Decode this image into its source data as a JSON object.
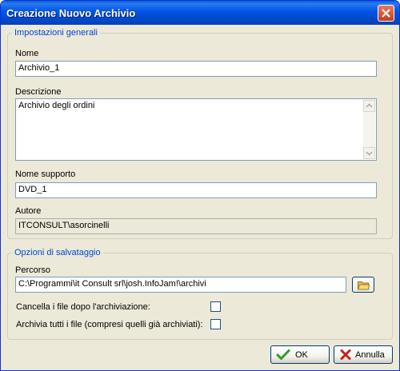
{
  "window": {
    "title": "Creazione Nuovo Archivio"
  },
  "general": {
    "legend": "Impostazioni generali",
    "name_label": "Nome",
    "name_value": "Archivio_1",
    "description_label": "Descrizione",
    "description_value": "Archivio degli ordini",
    "support_label": "Nome supporto",
    "support_value": "DVD_1",
    "author_label": "Autore",
    "author_value": "ITCONSULT\\asorcinelli"
  },
  "save": {
    "legend": "Opzioni di salvataggio",
    "path_label": "Percorso",
    "path_value": "C:\\Programmi\\it Consult srl\\josh.InfoJam!\\archivi",
    "delete_files_label": "Cancella i file dopo l'archiviazione:",
    "delete_files_checked": false,
    "archive_all_label": "Archivia tutti i file (compresi quelli già archiviati):",
    "archive_all_checked": false
  },
  "buttons": {
    "ok": "OK",
    "cancel": "Annulla"
  },
  "icons": {
    "close": "close-icon",
    "folder": "folder-icon",
    "ok": "checkmark-icon",
    "cancel": "x-icon"
  },
  "colors": {
    "titlebar": "#0054e3",
    "legend": "#0046d5",
    "dialog_bg": "#ece9d8"
  }
}
